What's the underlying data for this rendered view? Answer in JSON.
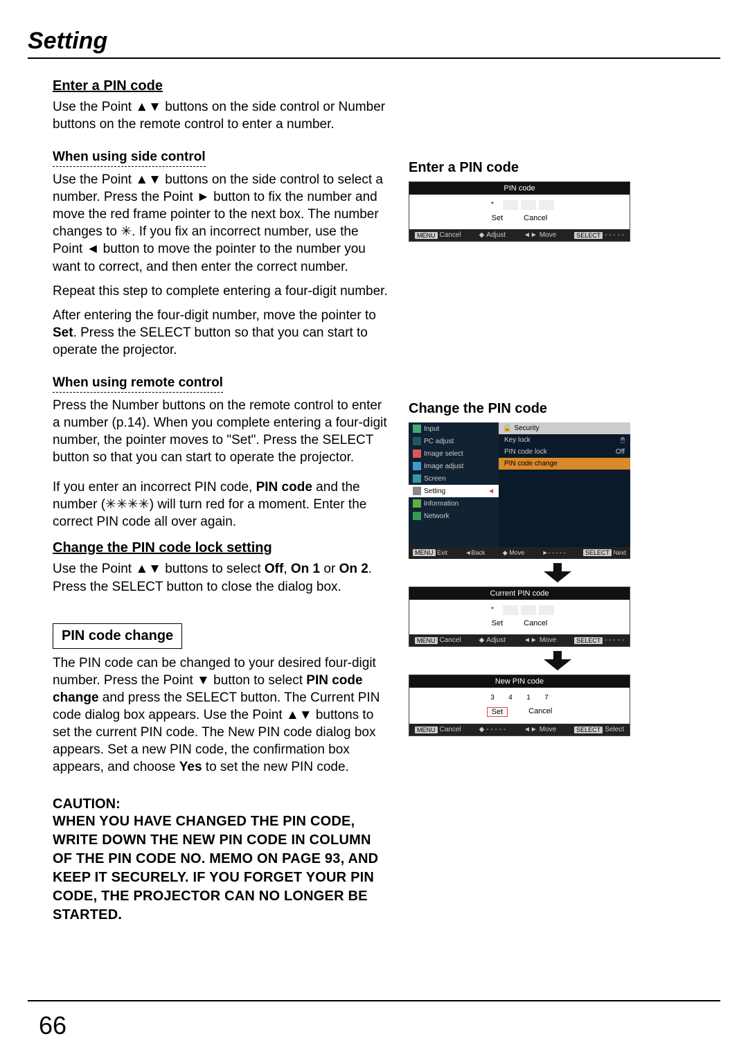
{
  "page": {
    "title": "Setting",
    "number": "66"
  },
  "left": {
    "h_enter": "Enter a PIN code",
    "p_enter": "Use the Point ▲▼ buttons on the side control or Number buttons on the remote control to enter a number.",
    "h_side": "When using side control",
    "p_side_1": "Use the Point ▲▼ buttons on the side control to select a number. Press the Point ► button to fix the number and move the red frame pointer to the next box. The number changes to ✳. If you fix an incorrect number, use the Point ◄ button to move the pointer to the number you want to correct, and then enter the correct number.",
    "p_side_2": "Repeat this step to complete entering a four-digit number.",
    "p_side_3_a": "After entering the four-digit number, move the pointer to ",
    "p_side_3_b": "Set",
    "p_side_3_c": ". Press the SELECT button so that you can start to operate the projector.",
    "h_remote": "When using remote control",
    "p_remote": "Press the Number buttons on the remote control to enter a number (p.14). When you complete entering a four-digit number, the pointer moves to \"Set\". Press the SELECT button so that you can start to operate the projector.",
    "p_error_a": "If you enter an incorrect PIN code, ",
    "p_error_b": "PIN code",
    "p_error_c": " and the number (✳✳✳✳) will turn red for a moment. Enter the correct PIN code all over again.",
    "h_change_lock": "Change the PIN code lock setting",
    "p_change_lock_a": "Use the Point ▲▼ buttons to select ",
    "p_change_lock_b": "Off",
    "p_change_lock_c": ", ",
    "p_change_lock_d": "On 1",
    "p_change_lock_e": " or ",
    "p_change_lock_f": "On 2",
    "p_change_lock_g": ". Press the SELECT button to close the dialog box.",
    "box_label": "PIN code change",
    "p_box_a": "The PIN code can be changed to your desired four-digit number. Press the Point ▼ button to select ",
    "p_box_b": "PIN code change",
    "p_box_c": " and press the SELECT button. The Current PIN code dialog box appears. Use the Point ▲▼ buttons to set the current PIN code. The New PIN code dialog box appears. Set a new PIN code, the confirmation box appears, and choose ",
    "p_box_d": "Yes",
    "p_box_e": " to set the new PIN code.",
    "caution_h": "CAUTION:",
    "caution_body": "WHEN YOU HAVE CHANGED THE PIN CODE, WRITE DOWN THE NEW PIN CODE IN COLUMN OF THE PIN CODE NO. MEMO ON PAGE 93, AND KEEP IT SECURELY. IF YOU FORGET YOUR PIN CODE, THE PROJECTOR CAN NO LONGER BE STARTED."
  },
  "right": {
    "title1": "Enter a PIN code",
    "pin1": {
      "title": "PIN code",
      "cells": [
        "*",
        "",
        "",
        ""
      ],
      "set": "Set",
      "cancel": "Cancel",
      "hints": {
        "menu": "MENU",
        "cancel": "Cancel",
        "adjust": "Adjust",
        "move": "Move",
        "select": "SELECT",
        "dash": "- - - - -"
      }
    },
    "title2": "Change the PIN code",
    "menu": {
      "left_items": [
        "Input",
        "PC adjust",
        "Image select",
        "Image adjust",
        "Screen",
        "Setting",
        "Information",
        "Network"
      ],
      "selected": "Setting",
      "right_header": "Security",
      "right_items": [
        {
          "label": "Key lock",
          "val": ""
        },
        {
          "label": "PIN code lock",
          "val": "Off"
        },
        {
          "label": "PIN code change",
          "val": ""
        }
      ],
      "right_highlight": "PIN code change",
      "hints": {
        "menu": "MENU",
        "exit": "Exit",
        "back": "Back",
        "move": "Move",
        "dash": "- - - - -",
        "select": "SELECT",
        "next": "Next"
      }
    },
    "pin2": {
      "title": "Current PIN code",
      "cells": [
        "*",
        "",
        "",
        ""
      ],
      "set": "Set",
      "cancel": "Cancel",
      "hints": {
        "menu": "MENU",
        "cancel": "Cancel",
        "adjust": "Adjust",
        "move": "Move",
        "select": "SELECT",
        "dash": "- - - - -"
      }
    },
    "pin3": {
      "title": "New PIN code",
      "cells": [
        "3",
        "4",
        "1",
        "7"
      ],
      "set": "Set",
      "cancel": "Cancel",
      "hints": {
        "menu": "MENU",
        "cancel": "Cancel",
        "updown": "- - - - -",
        "move": "Move",
        "select": "SELECT",
        "sel": "Select"
      }
    }
  }
}
